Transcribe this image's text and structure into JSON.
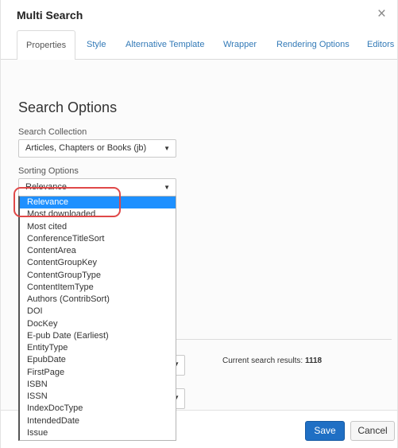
{
  "dialog": {
    "title": "Multi Search",
    "close_glyph": "×"
  },
  "tabs": [
    {
      "label": "Properties",
      "active": true
    },
    {
      "label": "Style"
    },
    {
      "label": "Alternative Template"
    },
    {
      "label": "Wrapper"
    },
    {
      "label": "Rendering Options"
    },
    {
      "label": "Editors"
    }
  ],
  "search_options": {
    "heading": "Search Options",
    "collection_label": "Search Collection",
    "collection_value": "Articles, Chapters or Books (jb)",
    "sorting_label": "Sorting Options",
    "sorting_value": "Relevance",
    "caret_glyph": "▼"
  },
  "dropdown_options": [
    "Relevance",
    "Most downloaded",
    "Most cited",
    "ConferenceTitleSort",
    "ContentArea",
    "ContentGroupKey",
    "ContentGroupType",
    "ContentItemType",
    "Authors (ContribSort)",
    "DOI",
    "DocKey",
    "E-pub Date (Earliest)",
    "EntityType",
    "EpubDate",
    "FirstPage",
    "ISBN",
    "ISSN",
    "IndexDocType",
    "IntendedDate",
    "Issue"
  ],
  "selected_option_index": 0,
  "results": {
    "label": "Current search results:",
    "count": "1118"
  },
  "footer": {
    "save_label": "Save",
    "cancel_label": "Cancel"
  },
  "colors": {
    "selected_option_bg": "#1e90ff",
    "annotation_outline": "#e04848",
    "save_button_bg": "#1f6fc4",
    "tab_link": "#337ab7"
  }
}
